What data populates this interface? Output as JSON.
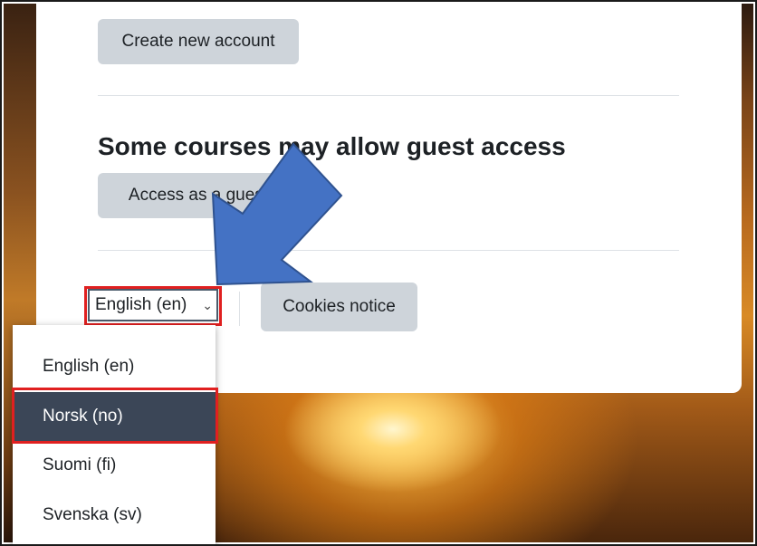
{
  "login": {
    "create_account_label": "Create new account",
    "guest_heading": "Some courses may allow guest access",
    "guest_button_label": "Access as a guest",
    "cookies_label": "Cookies notice"
  },
  "language_select": {
    "selected_value": "English (en)",
    "chevron": "⌄",
    "options": [
      {
        "label": "English (en)",
        "selected": false
      },
      {
        "label": "Norsk (no)",
        "selected": true
      },
      {
        "label": "Suomi (fi)",
        "selected": false
      },
      {
        "label": "Svenska (sv)",
        "selected": false
      }
    ]
  },
  "annotations": {
    "arrow_color": "#4472c4",
    "highlight_color": "#e02020"
  }
}
